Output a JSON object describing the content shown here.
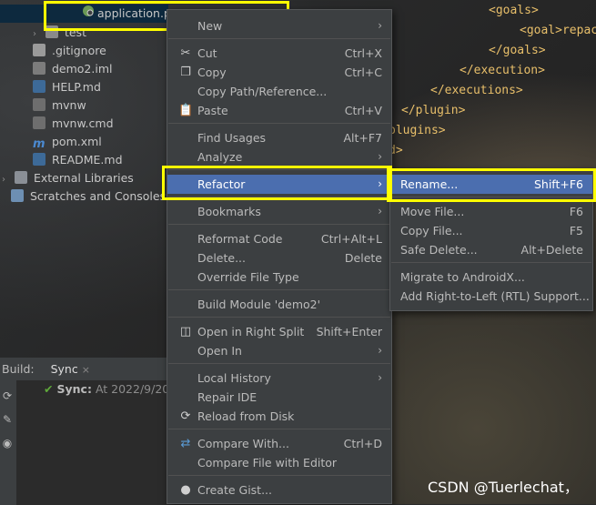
{
  "colors": {
    "menu_bg": "#3c3f41",
    "highlight": "#4b6eaf",
    "annotation": "#ffff00",
    "xml_tag": "#e8bf6a"
  },
  "tree": {
    "items": [
      {
        "label": "application.p",
        "icon": "spring-yml-icon"
      },
      {
        "label": "test",
        "icon": "folder-icon"
      },
      {
        "label": ".gitignore",
        "icon": "file-icon"
      },
      {
        "label": "demo2.iml",
        "icon": "iml-file-icon"
      },
      {
        "label": "HELP.md",
        "icon": "markdown-icon"
      },
      {
        "label": "mvnw",
        "icon": "script-icon"
      },
      {
        "label": "mvnw.cmd",
        "icon": "script-icon"
      },
      {
        "label": "pom.xml",
        "icon": "maven-icon"
      },
      {
        "label": "README.md",
        "icon": "markdown-icon"
      },
      {
        "label": "External Libraries",
        "icon": "library-icon"
      },
      {
        "label": "Scratches and Consoles",
        "icon": "scratches-icon"
      }
    ]
  },
  "code": {
    "lines": [
      "<goals>",
      "<goal>repac",
      "</goals>",
      "</execution>",
      "</executions>",
      "</plugin>",
      "plugins>",
      "d>"
    ]
  },
  "build": {
    "label": "Build:",
    "tab": "Sync",
    "tab_close": "×",
    "status_bold": "Sync:",
    "status_text": "At 2022/9/20 1"
  },
  "context_menu": {
    "items": [
      {
        "label": "New",
        "submenu": true
      },
      {
        "label": "Cut",
        "shortcut": "Ctrl+X",
        "icon": "cut-icon"
      },
      {
        "label": "Copy",
        "shortcut": "Ctrl+C",
        "icon": "copy-icon"
      },
      {
        "label": "Copy Path/Reference..."
      },
      {
        "label": "Paste",
        "shortcut": "Ctrl+V",
        "icon": "paste-icon"
      },
      {
        "label": "Find Usages",
        "shortcut": "Alt+F7"
      },
      {
        "label": "Analyze",
        "submenu": true
      },
      {
        "label": "Refactor",
        "submenu": true
      },
      {
        "label": "Bookmarks",
        "submenu": true
      },
      {
        "label": "Reformat Code",
        "shortcut": "Ctrl+Alt+L"
      },
      {
        "label": "Delete...",
        "shortcut": "Delete"
      },
      {
        "label": "Override File Type"
      },
      {
        "label": "Build Module 'demo2'"
      },
      {
        "label": "Open in Right Split",
        "shortcut": "Shift+Enter",
        "icon": "split-icon"
      },
      {
        "label": "Open In",
        "submenu": true
      },
      {
        "label": "Local History",
        "submenu": true
      },
      {
        "label": "Repair IDE"
      },
      {
        "label": "Reload from Disk",
        "icon": "reload-icon"
      },
      {
        "label": "Compare With...",
        "shortcut": "Ctrl+D",
        "icon": "compare-icon"
      },
      {
        "label": "Compare File with Editor"
      },
      {
        "label": "Create Gist...",
        "icon": "github-icon"
      }
    ]
  },
  "refactor_menu": {
    "items": [
      {
        "label": "Rename...",
        "shortcut": "Shift+F6"
      },
      {
        "label": "Move File...",
        "shortcut": "F6"
      },
      {
        "label": "Copy File...",
        "shortcut": "F5"
      },
      {
        "label": "Safe Delete...",
        "shortcut": "Alt+Delete"
      },
      {
        "label": "Migrate to AndroidX..."
      },
      {
        "label": "Add Right-to-Left (RTL) Support..."
      }
    ]
  },
  "watermark": "CSDN @Tuerlechat，"
}
